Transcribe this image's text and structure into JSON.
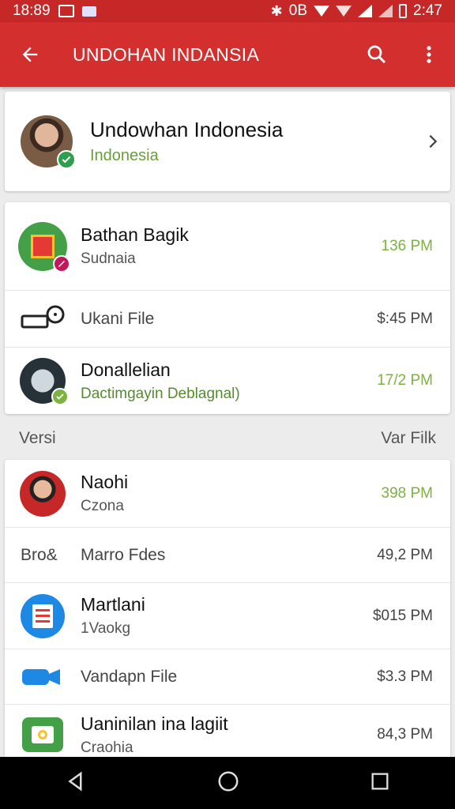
{
  "status_bar": {
    "time": "18:89",
    "right_text": "0B",
    "clock_right": "2:47"
  },
  "app_bar": {
    "title": "UNDOHAN INDANSIA"
  },
  "profile": {
    "name": "Undowhan Indonesia",
    "subtitle": "Indonesia"
  },
  "group1": [
    {
      "title": "Bathan Bagik",
      "subtitle": "Sudnaia",
      "time": "136 PM",
      "time_green": true
    },
    {
      "label": "Ukani File",
      "time": "$:45 PM",
      "time_green": false
    },
    {
      "title": "Donallelian",
      "subtitle": "Dactimgayin Deblagnal)",
      "time": "17/2 PM",
      "time_green": true
    }
  ],
  "section_header": {
    "left": "Versi",
    "right": "Var Filk"
  },
  "group2": [
    {
      "title": "Naohi",
      "subtitle": "Czona",
      "time": "398 PM",
      "time_green": true
    },
    {
      "lead_text": "Bro&",
      "label": "Marro Fdes",
      "time": "49,2 PM",
      "time_green": false
    },
    {
      "title": "Martlani",
      "subtitle": "1Vaokg",
      "time": "$015 PM",
      "time_green": false
    },
    {
      "label": "Vandapn File",
      "time": "$3.3 PM",
      "time_green": false
    },
    {
      "title": "Uaninilan ina lagiit",
      "subtitle": "Craohia",
      "time": "84,3 PM",
      "time_green": false
    }
  ],
  "colors": {
    "primary": "#d32f2f",
    "status": "#c62828",
    "accent_green": "#7cb342"
  }
}
